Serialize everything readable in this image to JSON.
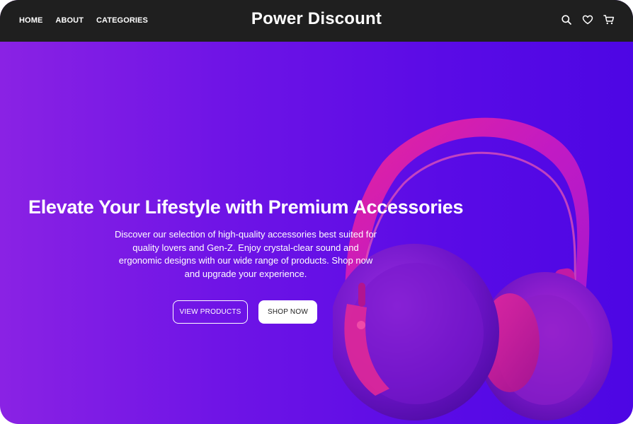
{
  "nav": {
    "links": [
      "HOME",
      "ABOUT",
      "CATEGORIES"
    ],
    "brand": "Power Discount",
    "icons": [
      "search-icon",
      "heart-icon",
      "cart-icon"
    ]
  },
  "hero": {
    "title": "Elevate Your Lifestyle with Premium Accessories",
    "description": "Discover our selection of high-quality accessories best suited for quality lovers and Gen-Z. Enjoy crystal-clear sound and ergonomic designs with our wide range of products. Shop now and upgrade your experience.",
    "primary_button": "VIEW PRODUCTS",
    "secondary_button": "SHOP NOW",
    "image": "headphones"
  },
  "colors": {
    "navbar": "#1f1f1f",
    "gradient_start": "#8a22e4",
    "gradient_end": "#4d06e4",
    "accent_pink": "#e0209a"
  }
}
